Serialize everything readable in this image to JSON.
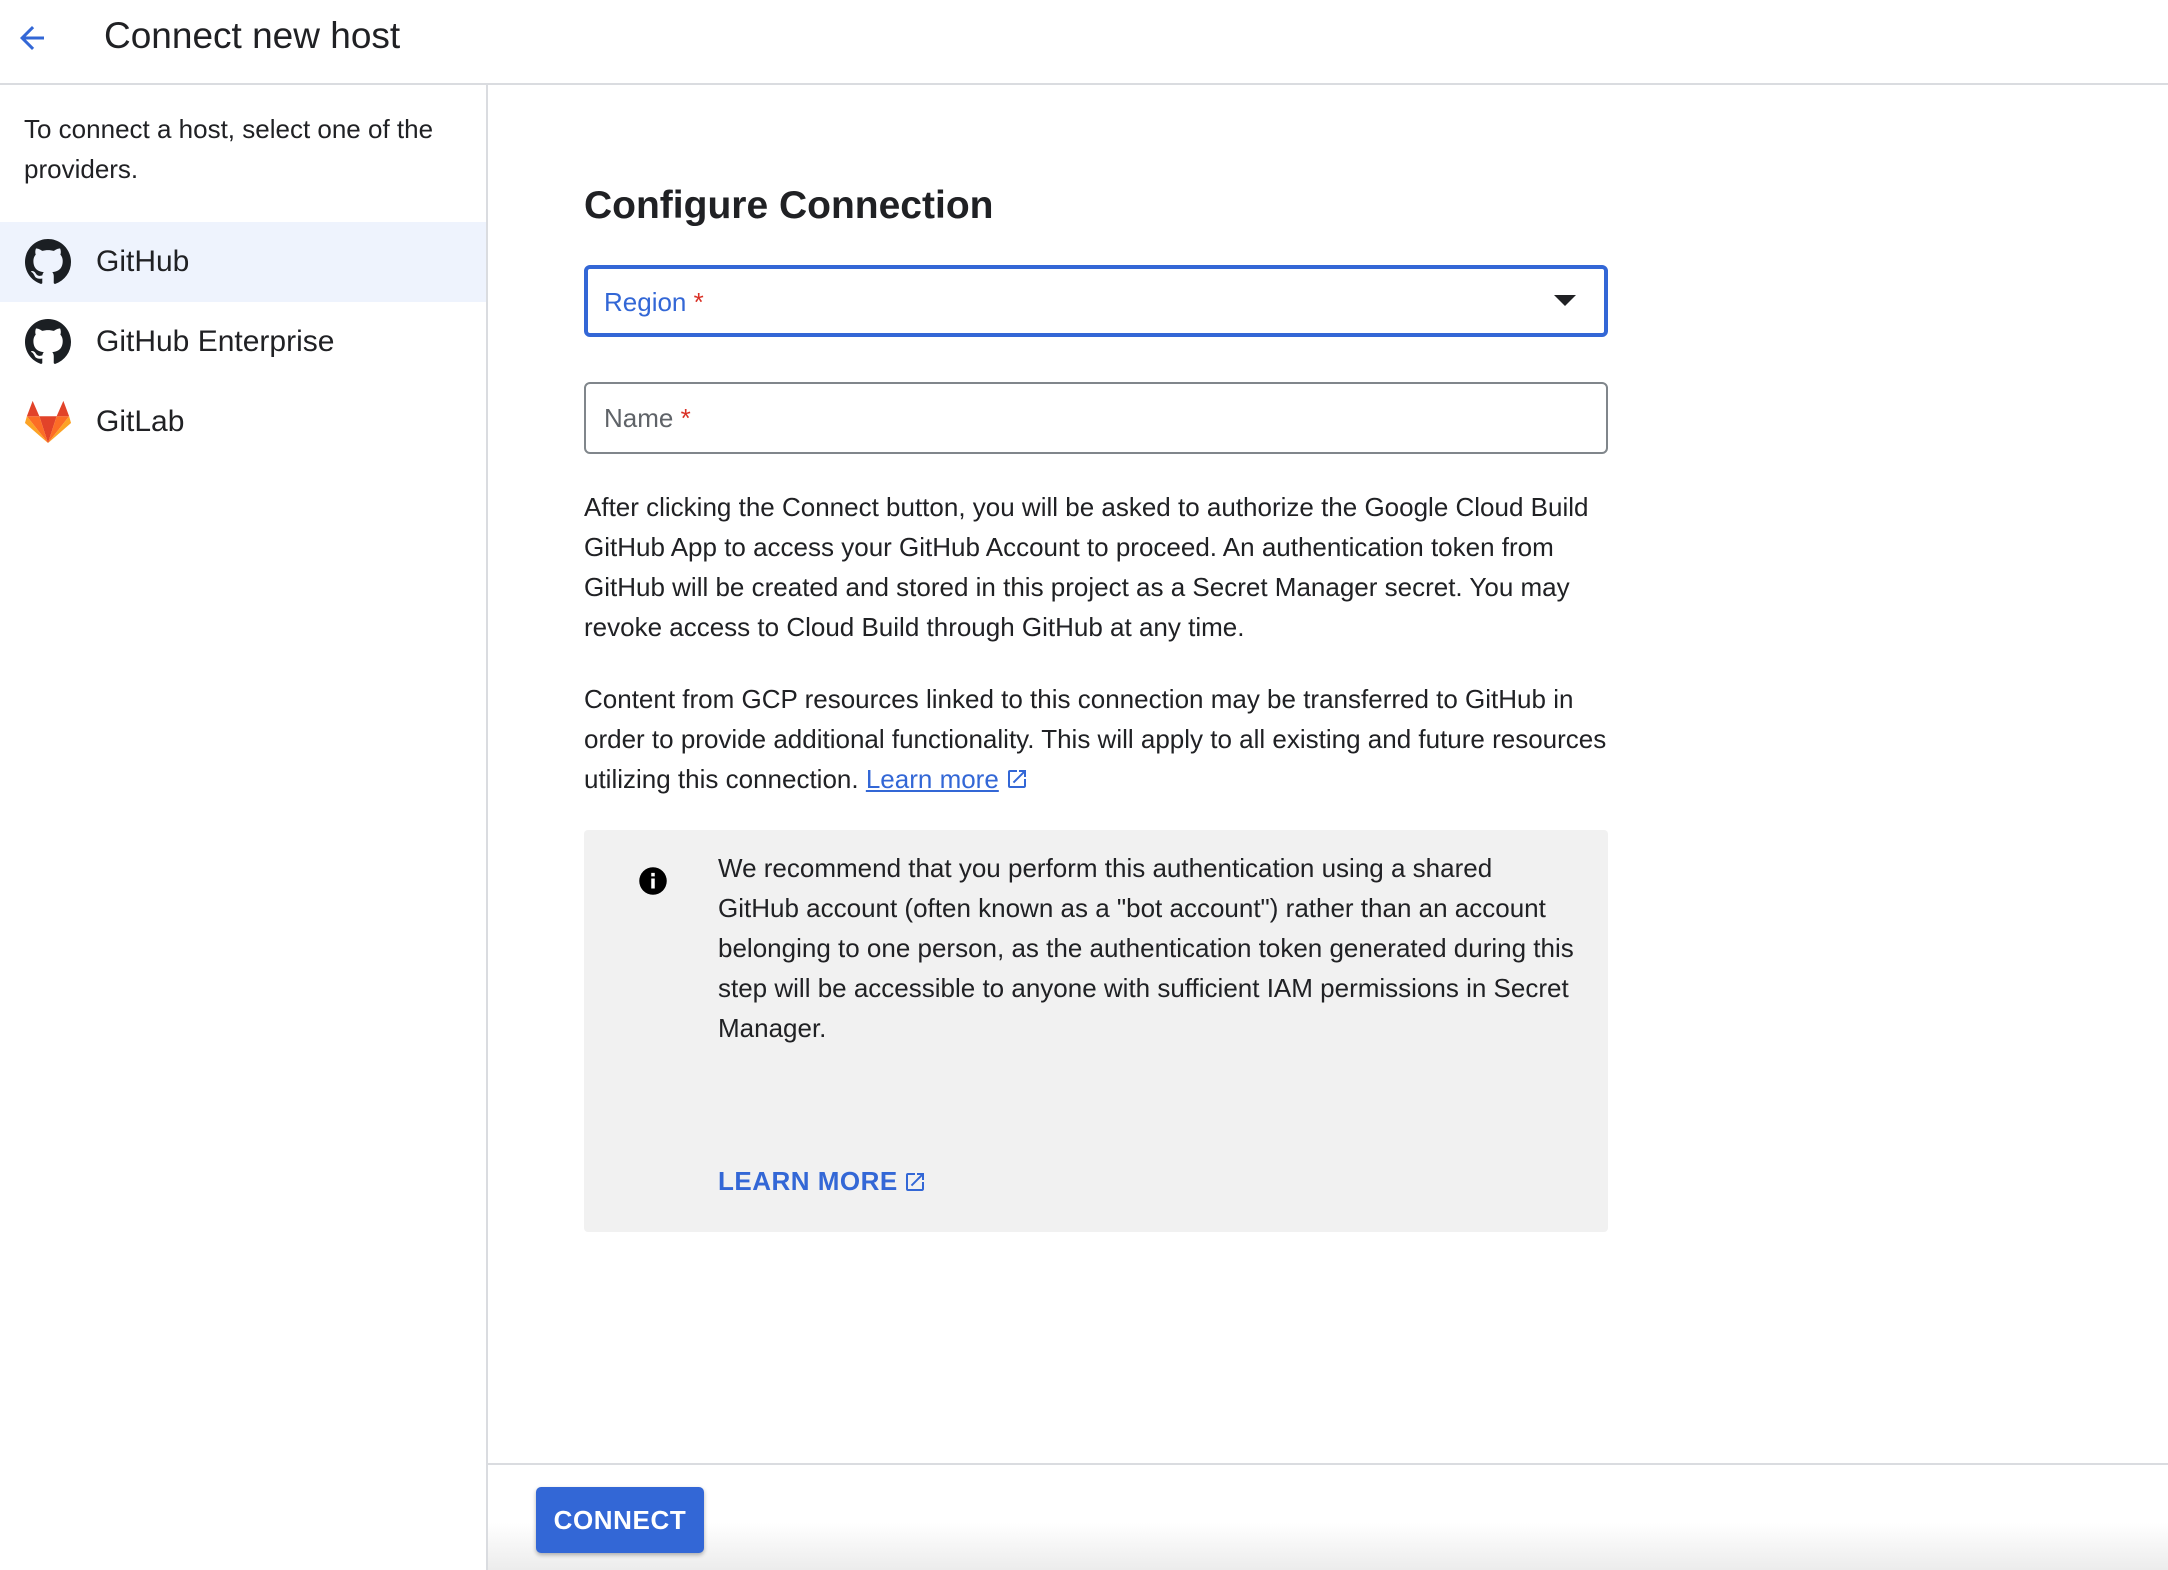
{
  "header": {
    "title": "Connect new host",
    "back_icon": "arrow-back-icon"
  },
  "sidebar": {
    "intro": "To connect a host, select one of the providers.",
    "providers": [
      {
        "label": "GitHub",
        "icon": "github-icon",
        "selected": true
      },
      {
        "label": "GitHub Enterprise",
        "icon": "github-icon",
        "selected": false
      },
      {
        "label": "GitLab",
        "icon": "gitlab-icon",
        "selected": false
      }
    ]
  },
  "form": {
    "title": "Configure Connection",
    "region_label": "Region",
    "name_label": "Name",
    "required_marker": "*",
    "paragraph1": "After clicking the Connect button, you will be asked to authorize the Google Cloud Build GitHub App to access your GitHub Account to proceed. An authentication token from GitHub will be created and stored in this project as a Secret Manager secret. You may revoke access to Cloud Build through GitHub at any time.",
    "paragraph2": "Content from GCP resources linked to this connection may be transferred to GitHub in order to provide additional functionality. This will apply to all existing and future resources utilizing this connection.",
    "learn_more_link": "Learn more"
  },
  "info_box": {
    "text": "We recommend that you perform this authentication using a shared GitHub account (often known as a \"bot account\") rather than an account belonging to one person, as the authentication token generated during this step will be accessible to anyone with sufficient IAM permissions in Secret Manager.",
    "link": "LEARN MORE",
    "icon": "info-icon"
  },
  "footer": {
    "connect_label": "CONNECT"
  },
  "colors": {
    "accent": "#3367d6",
    "required": "#d93025",
    "selected_bg": "#eef3fd",
    "info_bg": "#f1f1f1"
  }
}
